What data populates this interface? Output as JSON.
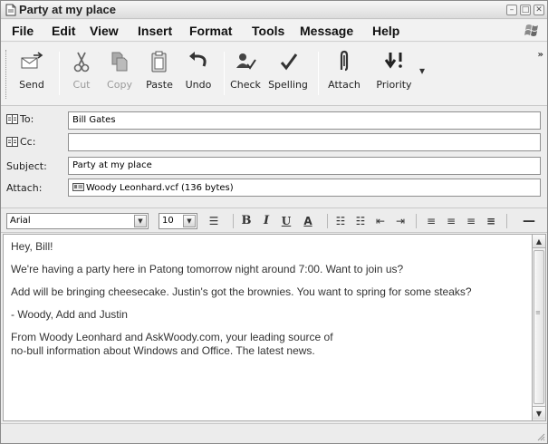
{
  "window": {
    "title": "Party at my place"
  },
  "menu": [
    "File",
    "Edit",
    "View",
    "Insert",
    "Format",
    "Tools",
    "Message",
    "Help"
  ],
  "toolbar": {
    "send": "Send",
    "cut": "Cut",
    "copy": "Copy",
    "paste": "Paste",
    "undo": "Undo",
    "check": "Check",
    "spelling": "Spelling",
    "attach": "Attach",
    "priority": "Priority",
    "more": "»"
  },
  "header": {
    "to_label": "To:",
    "to_value": "Bill Gates",
    "cc_label": "Cc:",
    "cc_value": "",
    "subject_label": "Subject:",
    "subject_value": "Party at my place",
    "attach_label": "Attach:",
    "attach_value": "Woody Leonhard.vcf (136 bytes)"
  },
  "format": {
    "font": "Arial",
    "size": "10"
  },
  "body": {
    "greeting": "Hey, Bill!",
    "p1": "We're having a party here in Patong tomorrow night around 7:00. Want to join us?",
    "p2": "Add will be bringing cheesecake. Justin's got the brownies. You want to spring for some steaks?",
    "p3": "- Woody, Add and Justin",
    "p4a": "From Woody Leonhard and AskWoody.com, your leading source of",
    "p4b": "no-bull information about Windows and Office. The latest news."
  }
}
